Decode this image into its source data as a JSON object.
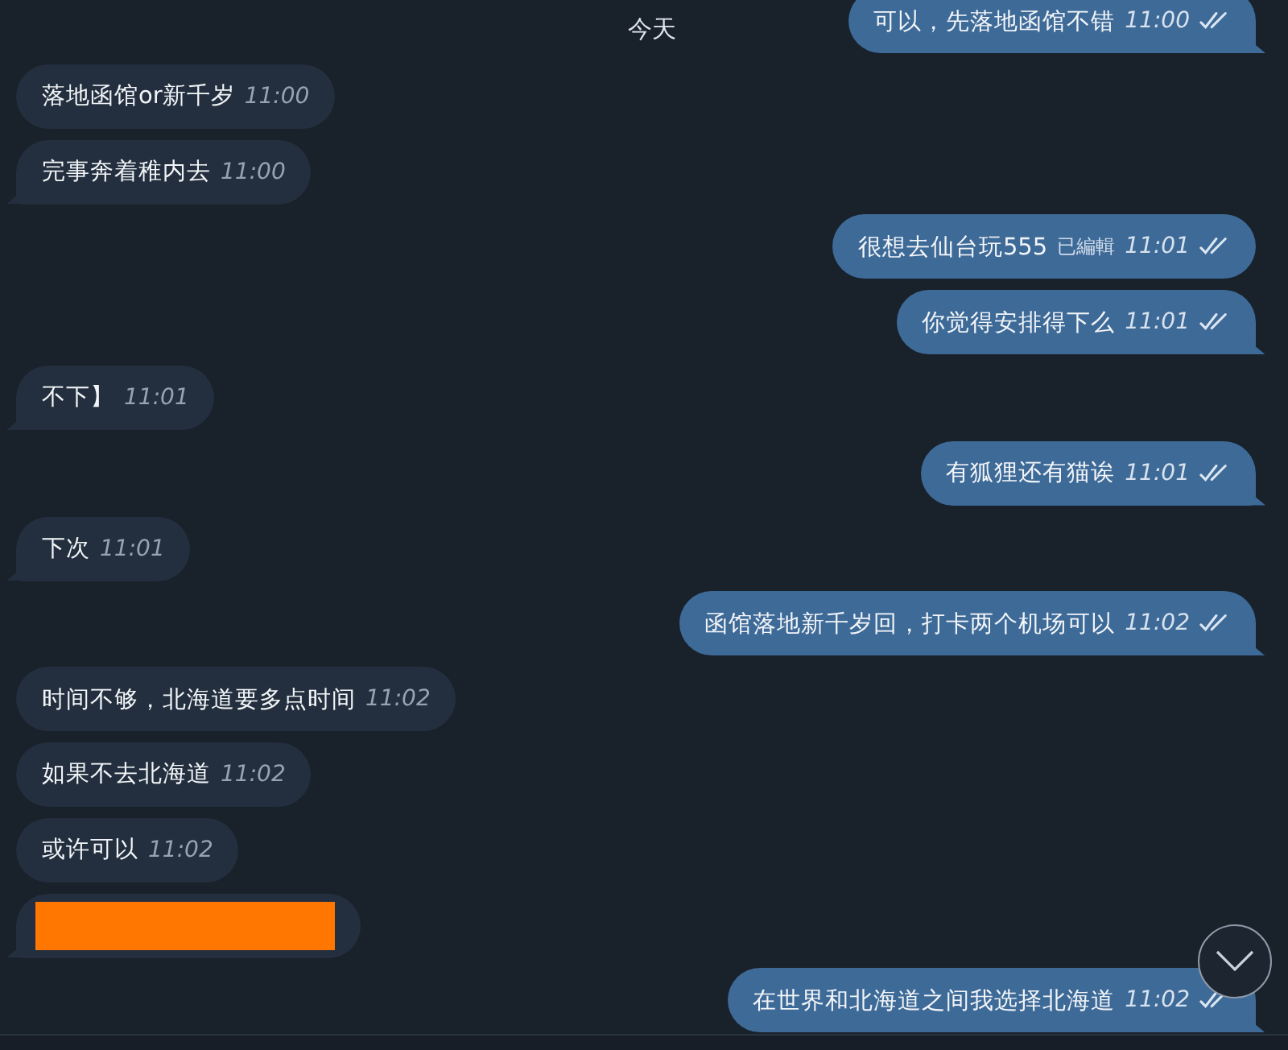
{
  "date_chip": "今天",
  "messages": [
    {
      "outgoing": true,
      "kind": "text",
      "text": "可以，先落地函馆不错",
      "time": "11:00",
      "read": true,
      "tail": true
    },
    {
      "outgoing": false,
      "kind": "text",
      "text": "落地函馆or新千岁",
      "time": "11:00",
      "tail": false
    },
    {
      "outgoing": false,
      "kind": "text",
      "text": "完事奔着稚内去",
      "time": "11:00",
      "tail": true
    },
    {
      "outgoing": true,
      "kind": "text",
      "text": "很想去仙台玩555",
      "edited": "已編輯",
      "time": "11:01",
      "read": true,
      "tail": false
    },
    {
      "outgoing": true,
      "kind": "text",
      "text": "你觉得安排得下么",
      "time": "11:01",
      "read": true,
      "tail": true
    },
    {
      "outgoing": false,
      "kind": "text",
      "text": "不下】",
      "time": "11:01",
      "tail": true
    },
    {
      "outgoing": true,
      "kind": "text",
      "text": "有狐狸还有猫诶",
      "time": "11:01",
      "read": true,
      "tail": true
    },
    {
      "outgoing": false,
      "kind": "text",
      "text": "下次",
      "time": "11:01",
      "tail": true
    },
    {
      "outgoing": true,
      "kind": "text",
      "text": "函馆落地新千岁回，打卡两个机场可以",
      "time": "11:02",
      "read": true,
      "tail": true
    },
    {
      "outgoing": false,
      "kind": "text",
      "text": "时间不够，北海道要多点时间",
      "time": "11:02",
      "tail": false
    },
    {
      "outgoing": false,
      "kind": "text",
      "text": "如果不去北海道",
      "time": "11:02",
      "tail": false
    },
    {
      "outgoing": false,
      "kind": "text",
      "text": "或许可以",
      "time": "11:02",
      "tail": false
    },
    {
      "outgoing": false,
      "kind": "redacted",
      "tail": true
    },
    {
      "outgoing": true,
      "kind": "text",
      "text": "在世界和北海道之间我选择北海道",
      "time": "11:02",
      "read": true,
      "tail": true
    }
  ]
}
